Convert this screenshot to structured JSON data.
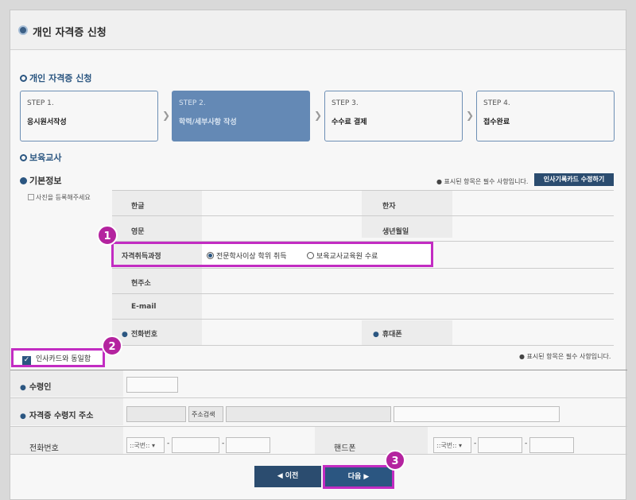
{
  "header": {
    "title": "개인 자격증 신청"
  },
  "section_apply": "개인 자격증 신청",
  "steps": [
    {
      "num": "STEP 1.",
      "title": "응시원서작성"
    },
    {
      "num": "STEP 2.",
      "title": "학력/세부사항 작성"
    },
    {
      "num": "STEP 3.",
      "title": "수수료 결제"
    },
    {
      "num": "STEP 4.",
      "title": "접수완료"
    }
  ],
  "section_teacher": "보육교사",
  "basic_info": {
    "title": "기본정보",
    "required_note": "● 표시된 항목은 필수 사항입니다.",
    "hr_card_button": "인사기록카드 수정하기",
    "photo_alt": "사진을 등록해주세요",
    "labels": {
      "korean": "한글",
      "hanja": "한자",
      "english": "영문",
      "birth": "생년월일",
      "course": "자격취득과정",
      "address": "현주소",
      "email": "E-mail",
      "phone": "전화번호",
      "mobile": "휴대폰"
    },
    "course_options": [
      "전문학사이상 학위 취득",
      "보육교사교육원 수료"
    ],
    "same_as_card": "인사카드와 동일함",
    "required_note2": "● 표시된 항목은 필수 사항입니다."
  },
  "receive": {
    "recipient_label": "수령인",
    "address_label": "자격증 수령지 주소",
    "address_search": "주소검색",
    "phone_label": "전화번호",
    "mobile_label": "핸드폰",
    "area_placeholder": "::국번::"
  },
  "buttons": {
    "prev": "◀ 이전",
    "next": "다음 ▶"
  },
  "badges": [
    "1",
    "2",
    "3"
  ],
  "colors": {
    "accent": "#2b5681",
    "highlight": "#c22cc2",
    "badge": "#b4239f",
    "active_step": "#6489b5"
  }
}
